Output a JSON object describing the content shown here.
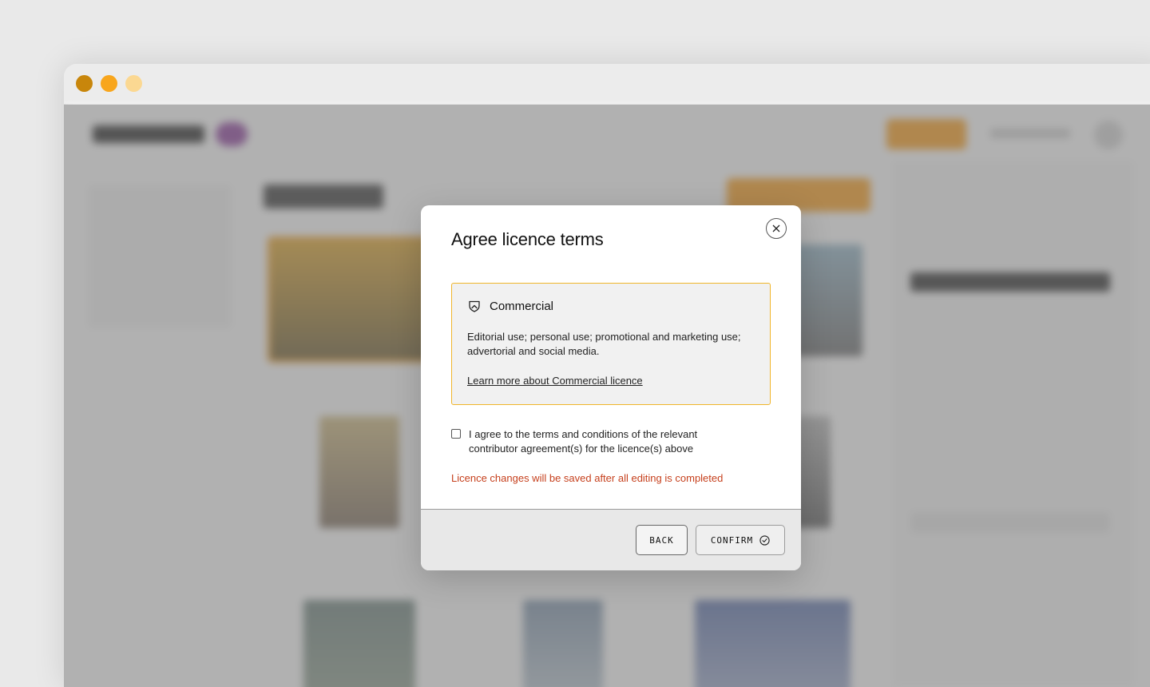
{
  "window": {
    "traffic_lights": [
      {
        "name": "close",
        "color": "#c8860b"
      },
      {
        "name": "minimize",
        "color": "#f8a61d"
      },
      {
        "name": "zoom",
        "color": "#fbd892"
      }
    ]
  },
  "modal": {
    "title": "Agree licence terms",
    "close_icon": "close-icon",
    "licence": {
      "icon": "shield-icon",
      "name": "Commercial",
      "description": "Editorial use; personal use; promotional and marketing use; advertorial and social media.",
      "link": "Learn more about Commercial licence"
    },
    "agreement": {
      "checked": false,
      "text": "I agree to the terms and conditions of the relevant contributor agreement(s) for the licence(s) above"
    },
    "notice": "Licence changes will be saved after all editing is completed",
    "footer": {
      "back_label": "BACK",
      "confirm_label": "CONFIRM",
      "confirm_icon": "check-circle-icon"
    }
  },
  "colors": {
    "accent": "#f0b52a",
    "notice": "#c6401d",
    "primary_button": "#f39a1c"
  }
}
